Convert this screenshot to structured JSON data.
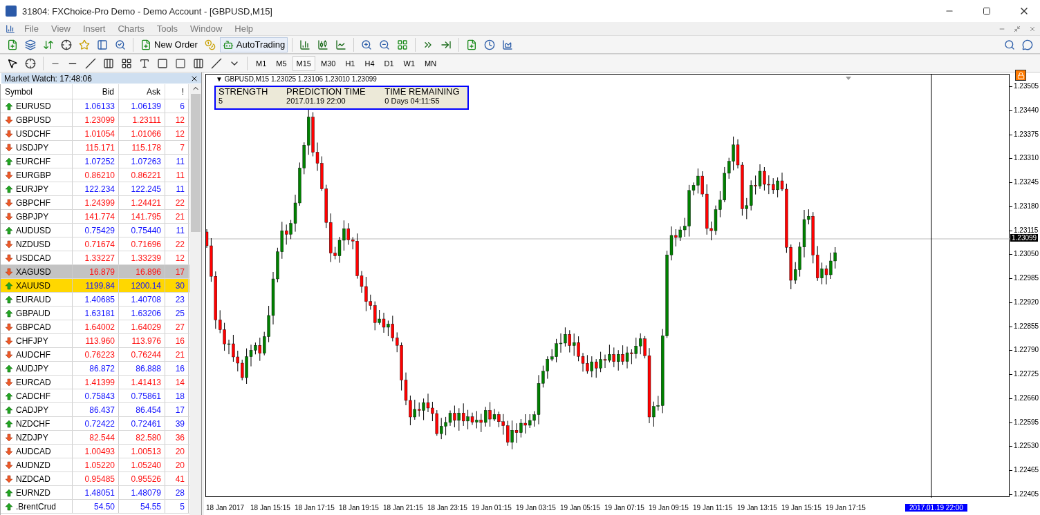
{
  "window": {
    "title": "31804: FXChoice-Pro Demo - Demo Account - [GBPUSD,M15]"
  },
  "menu": [
    "File",
    "View",
    "Insert",
    "Charts",
    "Tools",
    "Window",
    "Help"
  ],
  "toolbar": {
    "new_order": "New Order",
    "auto_trading": "AutoTrading"
  },
  "timeframes": [
    {
      "label": "M1",
      "selected": false
    },
    {
      "label": "M5",
      "selected": false
    },
    {
      "label": "M15",
      "selected": true
    },
    {
      "label": "M30",
      "selected": false
    },
    {
      "label": "H1",
      "selected": false
    },
    {
      "label": "H4",
      "selected": false
    },
    {
      "label": "D1",
      "selected": false
    },
    {
      "label": "W1",
      "selected": false
    },
    {
      "label": "MN",
      "selected": false
    }
  ],
  "market_watch": {
    "title": "Market Watch: 17:48:06",
    "columns": [
      "Symbol",
      "Bid",
      "Ask",
      "!"
    ],
    "rows": [
      {
        "symbol": "EURUSD",
        "bid": "1.06133",
        "ask": "1.06139",
        "spread": "6",
        "rising": true,
        "selected": false,
        "highlighted": false
      },
      {
        "symbol": "GBPUSD",
        "bid": "1.23099",
        "ask": "1.23111",
        "spread": "12",
        "rising": false,
        "selected": false,
        "highlighted": false
      },
      {
        "symbol": "USDCHF",
        "bid": "1.01054",
        "ask": "1.01066",
        "spread": "12",
        "rising": false,
        "selected": false,
        "highlighted": false
      },
      {
        "symbol": "USDJPY",
        "bid": "115.171",
        "ask": "115.178",
        "spread": "7",
        "rising": false,
        "selected": false,
        "highlighted": false
      },
      {
        "symbol": "EURCHF",
        "bid": "1.07252",
        "ask": "1.07263",
        "spread": "11",
        "rising": true,
        "selected": false,
        "highlighted": false
      },
      {
        "symbol": "EURGBP",
        "bid": "0.86210",
        "ask": "0.86221",
        "spread": "11",
        "rising": false,
        "selected": false,
        "highlighted": false
      },
      {
        "symbol": "EURJPY",
        "bid": "122.234",
        "ask": "122.245",
        "spread": "11",
        "rising": true,
        "selected": false,
        "highlighted": false
      },
      {
        "symbol": "GBPCHF",
        "bid": "1.24399",
        "ask": "1.24421",
        "spread": "22",
        "rising": false,
        "selected": false,
        "highlighted": false
      },
      {
        "symbol": "GBPJPY",
        "bid": "141.774",
        "ask": "141.795",
        "spread": "21",
        "rising": false,
        "selected": false,
        "highlighted": false
      },
      {
        "symbol": "AUDUSD",
        "bid": "0.75429",
        "ask": "0.75440",
        "spread": "11",
        "rising": true,
        "selected": false,
        "highlighted": false
      },
      {
        "symbol": "NZDUSD",
        "bid": "0.71674",
        "ask": "0.71696",
        "spread": "22",
        "rising": false,
        "selected": false,
        "highlighted": false
      },
      {
        "symbol": "USDCAD",
        "bid": "1.33227",
        "ask": "1.33239",
        "spread": "12",
        "rising": false,
        "selected": false,
        "highlighted": false
      },
      {
        "symbol": "XAGUSD",
        "bid": "16.879",
        "ask": "16.896",
        "spread": "17",
        "rising": false,
        "selected": true,
        "highlighted": false
      },
      {
        "symbol": "XAUUSD",
        "bid": "1199.84",
        "ask": "1200.14",
        "spread": "30",
        "rising": true,
        "selected": false,
        "highlighted": true
      },
      {
        "symbol": "EURAUD",
        "bid": "1.40685",
        "ask": "1.40708",
        "spread": "23",
        "rising": true,
        "selected": false,
        "highlighted": false
      },
      {
        "symbol": "GBPAUD",
        "bid": "1.63181",
        "ask": "1.63206",
        "spread": "25",
        "rising": true,
        "selected": false,
        "highlighted": false
      },
      {
        "symbol": "GBPCAD",
        "bid": "1.64002",
        "ask": "1.64029",
        "spread": "27",
        "rising": false,
        "selected": false,
        "highlighted": false
      },
      {
        "symbol": "CHFJPY",
        "bid": "113.960",
        "ask": "113.976",
        "spread": "16",
        "rising": false,
        "selected": false,
        "highlighted": false
      },
      {
        "symbol": "AUDCHF",
        "bid": "0.76223",
        "ask": "0.76244",
        "spread": "21",
        "rising": false,
        "selected": false,
        "highlighted": false
      },
      {
        "symbol": "AUDJPY",
        "bid": "86.872",
        "ask": "86.888",
        "spread": "16",
        "rising": true,
        "selected": false,
        "highlighted": false
      },
      {
        "symbol": "EURCAD",
        "bid": "1.41399",
        "ask": "1.41413",
        "spread": "14",
        "rising": false,
        "selected": false,
        "highlighted": false
      },
      {
        "symbol": "CADCHF",
        "bid": "0.75843",
        "ask": "0.75861",
        "spread": "18",
        "rising": true,
        "selected": false,
        "highlighted": false
      },
      {
        "symbol": "CADJPY",
        "bid": "86.437",
        "ask": "86.454",
        "spread": "17",
        "rising": true,
        "selected": false,
        "highlighted": false
      },
      {
        "symbol": "NZDCHF",
        "bid": "0.72422",
        "ask": "0.72461",
        "spread": "39",
        "rising": true,
        "selected": false,
        "highlighted": false
      },
      {
        "symbol": "NZDJPY",
        "bid": "82.544",
        "ask": "82.580",
        "spread": "36",
        "rising": false,
        "selected": false,
        "highlighted": false
      },
      {
        "symbol": "AUDCAD",
        "bid": "1.00493",
        "ask": "1.00513",
        "spread": "20",
        "rising": false,
        "selected": false,
        "highlighted": false
      },
      {
        "symbol": "AUDNZD",
        "bid": "1.05220",
        "ask": "1.05240",
        "spread": "20",
        "rising": false,
        "selected": false,
        "highlighted": false
      },
      {
        "symbol": "NZDCAD",
        "bid": "0.95485",
        "ask": "0.95526",
        "spread": "41",
        "rising": false,
        "selected": false,
        "highlighted": false
      },
      {
        "symbol": "EURNZD",
        "bid": "1.48051",
        "ask": "1.48079",
        "spread": "28",
        "rising": true,
        "selected": false,
        "highlighted": false
      },
      {
        "symbol": ".BrentCrud",
        "bid": "54.50",
        "ask": "54.55",
        "spread": "5",
        "rising": true,
        "selected": false,
        "highlighted": false
      }
    ]
  },
  "chart": {
    "header_marker": "▼",
    "header": "GBPUSD,M15  1.23025 1.23106 1.23010 1.23099",
    "info_panel": [
      {
        "heading": "STRENGTH",
        "value": "5"
      },
      {
        "heading": "PREDICTION TIME",
        "value": "2017.01.19 22:00"
      },
      {
        "heading": "TIME REMAINING",
        "value": "0 Days 04:11:55"
      }
    ],
    "price_ticks": [
      "1.23505",
      "1.23440",
      "1.23375",
      "1.23310",
      "1.23245",
      "1.23180",
      "1.23115",
      "1.23050",
      "1.22985",
      "1.22920",
      "1.22855",
      "1.22790",
      "1.22725",
      "1.22660",
      "1.22595",
      "1.22530",
      "1.22465",
      "1.22405"
    ],
    "current_price": "1.23099",
    "time_labels": [
      "18 Jan 2017",
      "18 Jan 15:15",
      "18 Jan 17:15",
      "18 Jan 19:15",
      "18 Jan 21:15",
      "18 Jan 23:15",
      "19 Jan 01:15",
      "19 Jan 03:15",
      "19 Jan 05:15",
      "19 Jan 07:15",
      "19 Jan 09:15",
      "19 Jan 11:15",
      "19 Jan 13:15",
      "19 Jan 15:15",
      "19 Jan 17:15"
    ],
    "prediction_label": "2017.01.19 22:00"
  }
}
